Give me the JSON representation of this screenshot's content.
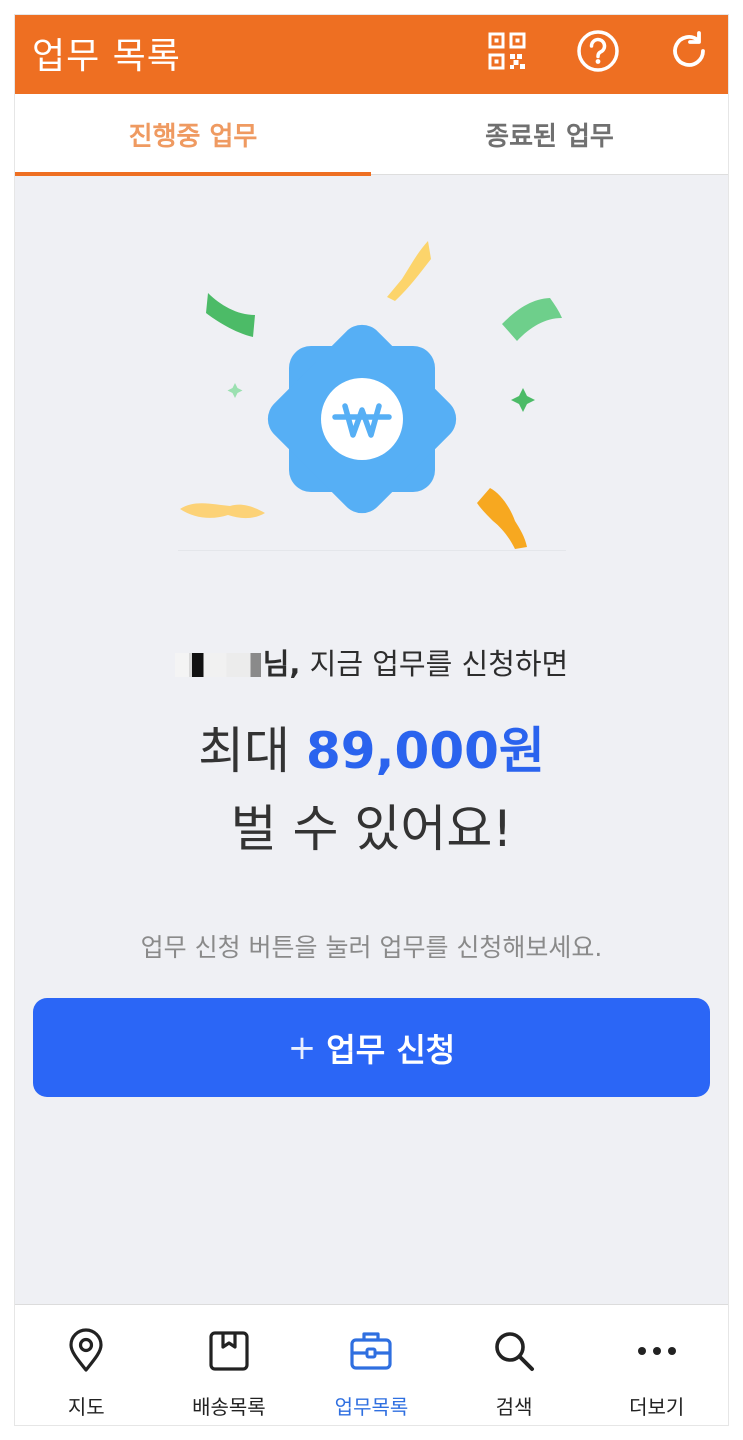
{
  "header": {
    "title": "업무 목록",
    "icons": [
      "qr-code-icon",
      "help-icon",
      "refresh-icon"
    ]
  },
  "tabs": [
    {
      "label": "진행중 업무",
      "active": true
    },
    {
      "label": "종료된 업무",
      "active": false
    }
  ],
  "promo": {
    "name_suffix": "님,",
    "greeting": " 지금 업무를 신청하면",
    "amount_prefix": "최대 ",
    "amount": "89,000원",
    "earn_text": "벌 수 있어요!",
    "hint": "업무 신청 버튼을 눌러 업무를 신청해보세요."
  },
  "apply_button": {
    "plus": "+",
    "label": "업무 신청"
  },
  "bottom_nav": [
    {
      "label": "지도",
      "icon": "map-pin-icon",
      "active": false
    },
    {
      "label": "배송목록",
      "icon": "box-icon",
      "active": false
    },
    {
      "label": "업무목록",
      "icon": "briefcase-icon",
      "active": true
    },
    {
      "label": "검색",
      "icon": "search-icon",
      "active": false
    },
    {
      "label": "더보기",
      "icon": "more-icon",
      "active": false
    }
  ],
  "colors": {
    "brand_orange": "#ee6f22",
    "active_tab_text": "#ef9a61",
    "primary_blue": "#2b66f6",
    "amount_blue": "#2a63ee",
    "badge_blue": "#56aff5",
    "background": "#eff0f4"
  }
}
